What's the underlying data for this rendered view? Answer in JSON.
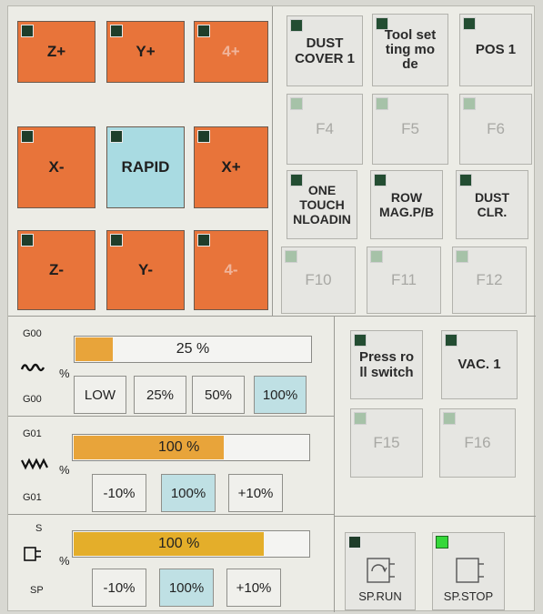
{
  "jog": {
    "z_plus": "Z+",
    "y_plus": "Y+",
    "a_plus": "4+",
    "x_minus": "X-",
    "rapid": "RAPID",
    "x_plus": "X+",
    "z_minus": "Z-",
    "y_minus": "Y-",
    "a_minus": "4-"
  },
  "fkeys": {
    "dust_cover": "DUST\nCOVER 1",
    "tool_setting": "Tool set\nting mo\nde",
    "pos1": "POS 1",
    "f4": "F4",
    "f5": "F5",
    "f6": "F6",
    "one_touch": "ONE\nTOUCH\nNLOADIN",
    "row_mag": "ROW\nMAG.P/B",
    "dust_clr": "DUST\nCLR.",
    "f10": "F10",
    "f11": "F11",
    "f12": "F12",
    "press_roll": "Press ro\nll switch",
    "vac1": "VAC. 1",
    "f15": "F15",
    "f16": "F16",
    "sp_run": "SP.RUN",
    "sp_stop": "SP.STOP"
  },
  "g00": {
    "label_top": "G00",
    "label_bottom": "G00",
    "unit": "%",
    "value_text": "25 %",
    "value": 25,
    "buttons": [
      "LOW",
      "25%",
      "50%",
      "100%"
    ],
    "selected": "100%",
    "fill_color": "#e8a43a"
  },
  "g01": {
    "label_top": "G01",
    "label_bottom": "G01",
    "unit": "%",
    "value_text": "100 %",
    "value": 100,
    "buttons": [
      "-10%",
      "100%",
      "+10%"
    ],
    "selected": "100%",
    "fill_color": "#e8a43a"
  },
  "spindle": {
    "label_top": "S",
    "label_bottom": "SP",
    "unit": "%",
    "value_text": "100 %",
    "value": 100,
    "buttons": [
      "-10%",
      "100%",
      "+10%"
    ],
    "selected": "100%",
    "fill_color": "#e4ae2a"
  },
  "colors": {
    "jog_orange": "#e8743a",
    "rapid_cyan": "#a9dbe2",
    "indicator_on": "#35d83a"
  }
}
